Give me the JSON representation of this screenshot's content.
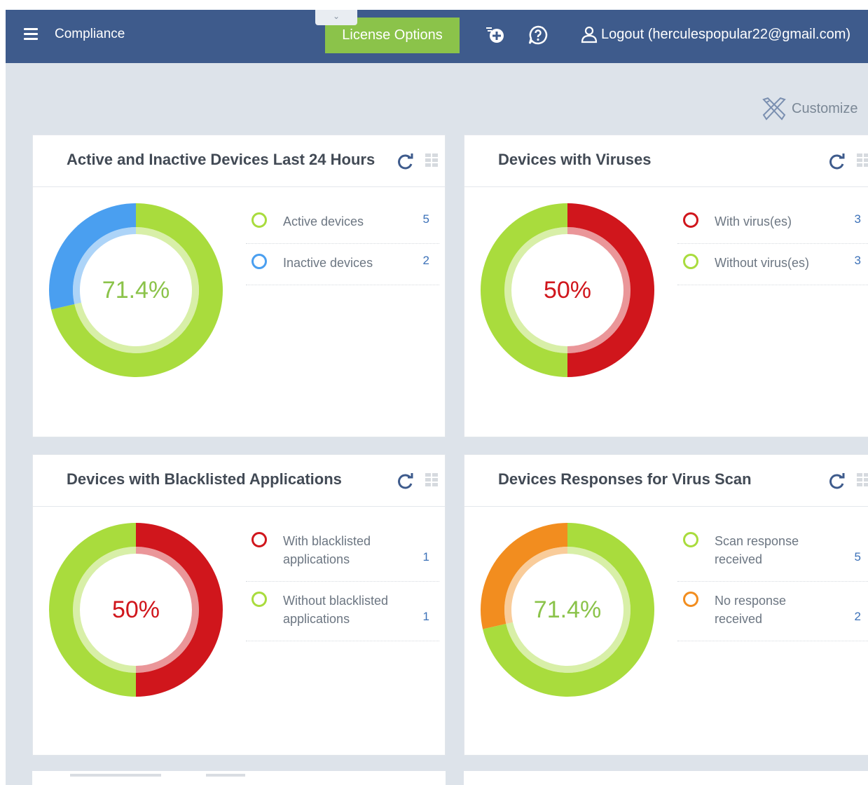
{
  "header": {
    "collapse_icon": "chevron-down-icon",
    "menu_icon": "hamburger-icon",
    "title": "Compliance",
    "license_button": "License Options",
    "add_icon": "add-ticket-icon",
    "help_icon": "help-icon",
    "logout_label": "Logout (herculespopular22@gmail.com)",
    "user_icon": "user-icon"
  },
  "toolbar": {
    "customize_label": "Customize",
    "customize_icon": "tools-icon"
  },
  "colors": {
    "topbar": "#3e5b8c",
    "license_button": "#8bc34a",
    "green": "#a9dc3d",
    "blue": "#4a9ff0",
    "red": "#d0161c",
    "orange": "#f28d1f",
    "count_link": "#3c71b8"
  },
  "cards": [
    {
      "title": "Active and Inactive Devices Last 24 Hours",
      "center_label": "71.4%",
      "center_color": "#8bc34a",
      "legend": [
        {
          "label": "Active devices",
          "count": "5",
          "color": "#a9dc3d"
        },
        {
          "label": "Inactive devices",
          "count": "2",
          "color": "#4a9ff0"
        }
      ]
    },
    {
      "title": "Devices with Viruses",
      "center_label": "50%",
      "center_color": "#d0161c",
      "legend": [
        {
          "label": "With virus(es)",
          "count": "3",
          "color": "#d0161c"
        },
        {
          "label": "Without virus(es)",
          "count": "3",
          "color": "#a9dc3d"
        }
      ]
    },
    {
      "title": "Devices with Blacklisted Applications",
      "center_label": "50%",
      "center_color": "#d0161c",
      "legend": [
        {
          "label": "With blacklisted applications",
          "count": "1",
          "color": "#d0161c"
        },
        {
          "label": "Without blacklisted applications",
          "count": "1",
          "color": "#a9dc3d"
        }
      ]
    },
    {
      "title": "Devices Responses for Virus Scan",
      "center_label": "71.4%",
      "center_color": "#8bc34a",
      "legend": [
        {
          "label": "Scan response received",
          "count": "5",
          "color": "#a9dc3d"
        },
        {
          "label": "No response received",
          "count": "2",
          "color": "#f28d1f"
        }
      ]
    }
  ],
  "chart_data": [
    {
      "type": "pie",
      "categories": [
        "Active devices",
        "Inactive devices"
      ],
      "values": [
        5,
        2
      ],
      "colors": [
        "#a9dc3d",
        "#4a9ff0"
      ]
    },
    {
      "type": "pie",
      "categories": [
        "With virus(es)",
        "Without virus(es)"
      ],
      "values": [
        3,
        3
      ],
      "colors": [
        "#d0161c",
        "#a9dc3d"
      ]
    },
    {
      "type": "pie",
      "categories": [
        "With blacklisted applications",
        "Without blacklisted applications"
      ],
      "values": [
        1,
        1
      ],
      "colors": [
        "#d0161c",
        "#a9dc3d"
      ]
    },
    {
      "type": "pie",
      "categories": [
        "Scan response received",
        "No response received"
      ],
      "values": [
        5,
        2
      ],
      "colors": [
        "#a9dc3d",
        "#f28d1f"
      ]
    }
  ]
}
